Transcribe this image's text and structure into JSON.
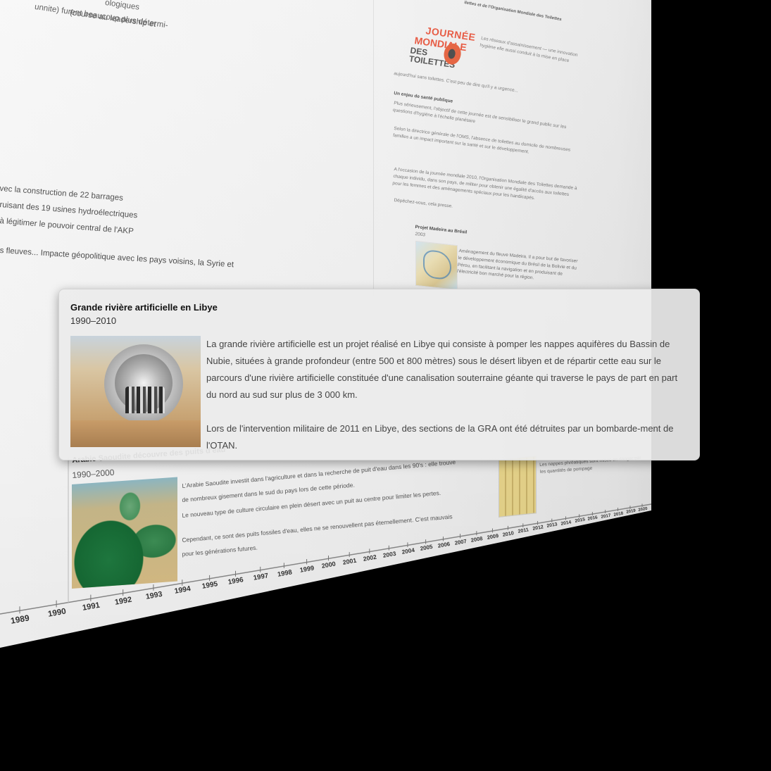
{
  "left_column": {
    "lines": [
      "ologiques",
      "(course au leadership et",
      "unnite) furent beaucoup plus détermi-",
      "vec la construction de 22 barrages",
      "ruisant des 19 usines hydroélectriques",
      "à légitimer le pouvoir central de l'AKP",
      "s fleuves... Impacte géopolitique avec les pays voisins, la Syrie et"
    ]
  },
  "right_column": {
    "header": "ilettes et de l'Organisation Mondiale des Toilettes",
    "logo": {
      "line1": "JOURNÉE",
      "line2": "MONDIALE",
      "line3": "DES TOILETTES"
    },
    "paragraphs": [
      "Les réseaux d'assainissement — une innovation hygiène elle aussi conduit à la mise en place",
      "aujourd'hui sans toilettes. C'est peu de dire qu'il y a urgence...",
      "Un enjeu de santé publique",
      "Plus sérieusement, l'objectif de cette journée est de sensibiliser le grand public sur les questions d'hygiène à l'échelle planétaire",
      "Selon la directrice générale de l'OMS, l'absence de toilettes au domicile de nombreuses familles a un impact important sur la santé et sur le développement.",
      "A l'occasion de la journée mondiale 2010, l'Organisation Mondiale des Toilettes demande à chaque individu, dans son pays, de militer pour obtenir une égalité d'accès aux toilettes pour les femmes et des aménagements spéciaux pour les handicapés.",
      "Dépêchez-vous, cela presse."
    ],
    "madeira": {
      "title": "Projet Madeira au Brésil",
      "year": "2003",
      "text": "Aménagement du fleuve Madeira. Il a pour but de favoriser le développement économique du Brésil de la Bolivie et du Pérou, en facilitant la navigation et en produisant de l'électricité bon marché pour la région."
    }
  },
  "saudi_card": {
    "title": "Arabie Saoudite découvre des puits d'eau",
    "years": "1990–2000",
    "lines": [
      "L'Arabie Saoudite investit dans l'agriculture et dans la recherche de puit d'eau dans les 90's : elle trouve",
      "de nombreux gisement dans le sud du pays lors de cette période.",
      "Le nouveau type de culture circulaire en plein désert avec un puit au centre pour limiter les pertes.",
      "Cependant, ce sont des puits fossiles d'eau, elles ne se renouvellent pas éternellement. C'est mauvais",
      "pour les générations futures."
    ]
  },
  "right_small_note": "Les nappes phréatiques sont mises en danger par les quantités de pompage",
  "timeline": {
    "years": [
      "1989",
      "1990",
      "1991",
      "1992",
      "1993",
      "1994",
      "1995",
      "1996",
      "1997",
      "1998",
      "1999",
      "2000",
      "2001",
      "2002",
      "2003",
      "2004",
      "2005",
      "2006",
      "2007",
      "2008",
      "2009",
      "2010",
      "2011",
      "2012",
      "2013",
      "2014",
      "2015",
      "2016",
      "2017",
      "2018",
      "2019",
      "2020"
    ]
  },
  "popup": {
    "title": "Grande rivière artificielle en Libye",
    "years": "1990–2010",
    "paragraph1": "La grande rivière artificielle est un projet réalisé en Libye qui consiste à pomper les nappes aquifères du Bassin de Nubie, situées à grande profondeur (entre 500 et 800 mètres) sous le désert libyen et de répartir cette eau sur le parcours d'une rivière artificielle constituée d'une canalisation souterraine géante qui traverse le pays de part en part du nord au sud sur plus de 3 000 km.",
    "paragraph2": "Lors de l'intervention militaire de 2011 en Libye, des sections de la GRA ont été détruites par un bombarde-ment de l'OTAN."
  }
}
